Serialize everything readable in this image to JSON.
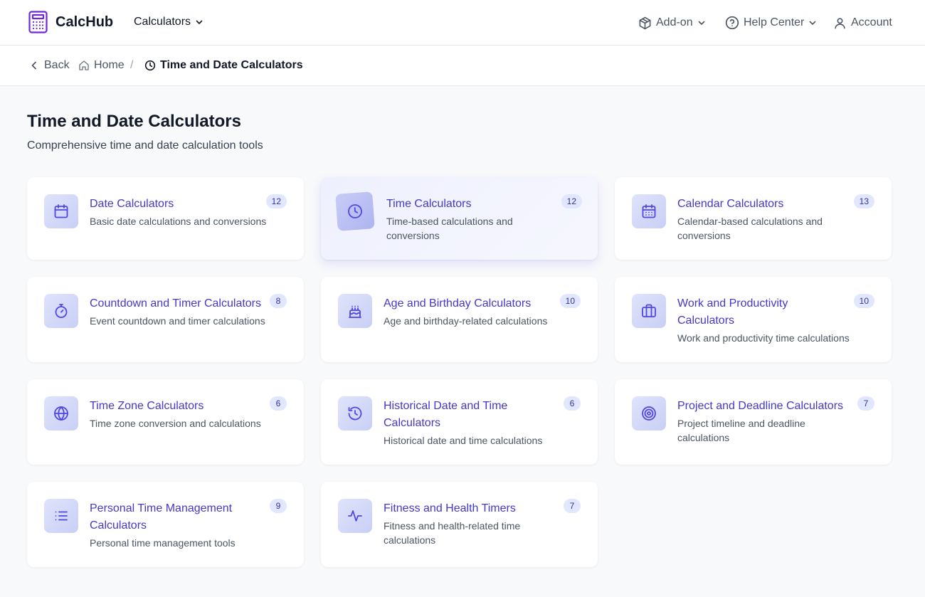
{
  "header": {
    "brand": "CalcHub",
    "calculators_label": "Calculators",
    "addon_label": "Add-on",
    "help_label": "Help Center",
    "account_label": "Account"
  },
  "breadcrumb": {
    "back": "Back",
    "home": "Home",
    "separator": "/",
    "current": "Time and Date Calculators"
  },
  "page": {
    "title": "Time and Date Calculators",
    "subtitle": "Comprehensive time and date calculation tools"
  },
  "categories": [
    {
      "title": "Date Calculators",
      "desc": "Basic date calculations and conversions",
      "count": "12",
      "icon": "calendar-icon"
    },
    {
      "title": "Time Calculators",
      "desc": "Time-based calculations and conversions",
      "count": "12",
      "icon": "clock-icon"
    },
    {
      "title": "Calendar Calculators",
      "desc": "Calendar-based calculations and conversions",
      "count": "13",
      "icon": "calendar-grid-icon"
    },
    {
      "title": "Countdown and Timer Calculators",
      "desc": "Event countdown and timer calculations",
      "count": "8",
      "icon": "timer-icon"
    },
    {
      "title": "Age and Birthday Calculators",
      "desc": "Age and birthday-related calculations",
      "count": "10",
      "icon": "cake-icon"
    },
    {
      "title": "Work and Productivity Calculators",
      "desc": "Work and productivity time calculations",
      "count": "10",
      "icon": "briefcase-icon"
    },
    {
      "title": "Time Zone Calculators",
      "desc": "Time zone conversion and calculations",
      "count": "6",
      "icon": "globe-icon"
    },
    {
      "title": "Historical Date and Time Calculators",
      "desc": "Historical date and time calculations",
      "count": "6",
      "icon": "history-icon"
    },
    {
      "title": "Project and Deadline Calculators",
      "desc": "Project timeline and deadline calculations",
      "count": "7",
      "icon": "target-icon"
    },
    {
      "title": "Personal Time Management Calculators",
      "desc": "Personal time management tools",
      "count": "9",
      "icon": "list-icon"
    },
    {
      "title": "Fitness and Health Timers",
      "desc": "Fitness and health-related time calculations",
      "count": "7",
      "icon": "activity-icon"
    }
  ],
  "colors": {
    "accent": "#4f46e5",
    "title_link": "#4338ca",
    "badge_bg": "#e0e7ff",
    "page_bg": "#f8f9fb"
  }
}
